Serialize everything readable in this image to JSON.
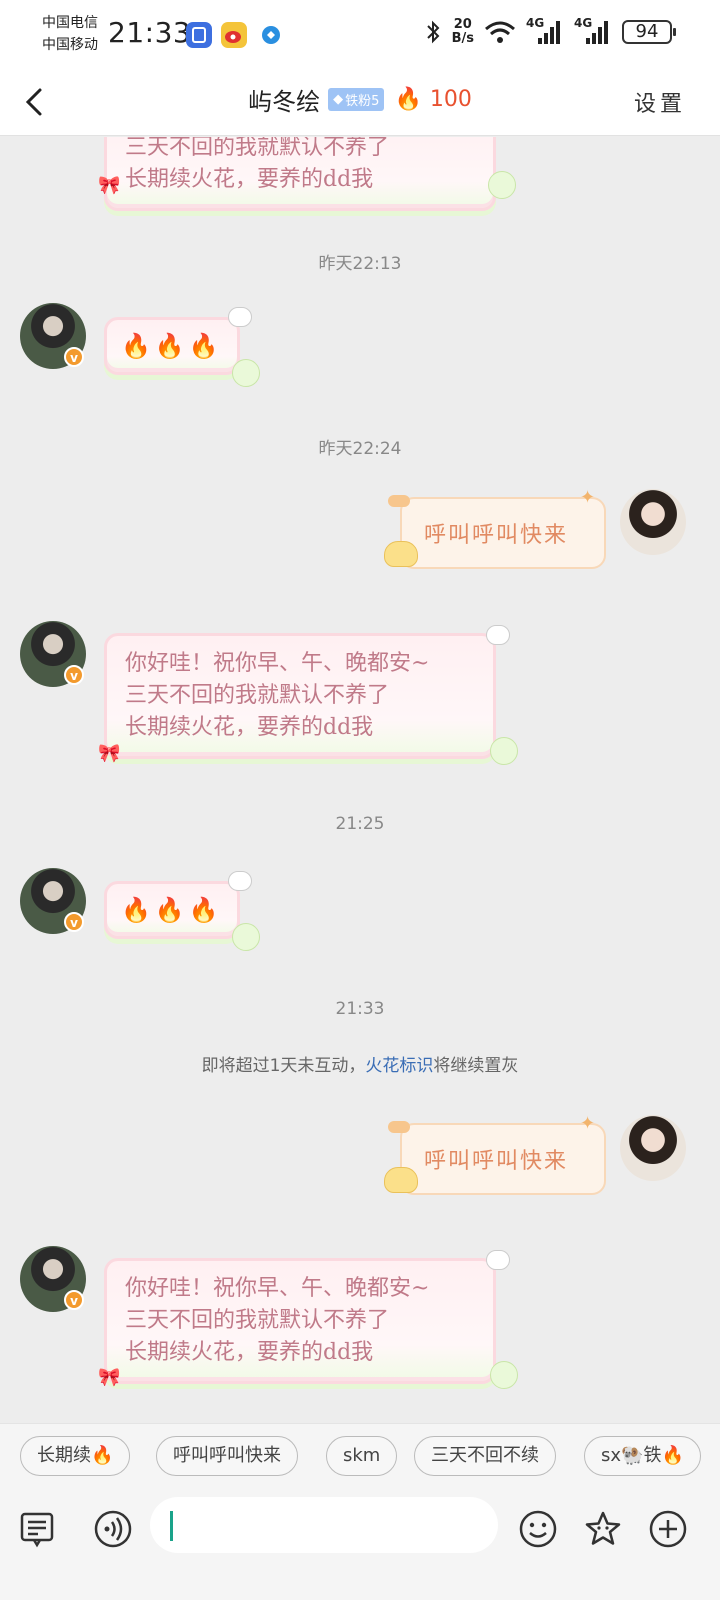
{
  "status_bar": {
    "carrier_1": "中国电信",
    "carrier_2": "中国移动",
    "time": "21:33",
    "net_speed_value": "20",
    "net_speed_unit": "B/s",
    "signal_1": "4G",
    "signal_2": "4G",
    "battery": "94"
  },
  "nav": {
    "title": "屿冬绘",
    "fan_badge": "铁粉5",
    "spark_count": "100",
    "settings_label": "设置"
  },
  "messages": {
    "msg_top": {
      "line1": "三天不回的我就默认不养了",
      "line2": "长期续火花，要养的dd我"
    },
    "time_1": "昨天22:13",
    "msg_fire_1": "🔥🔥🔥",
    "time_2": "昨天22:24",
    "msg_out_1": "呼叫呼叫快来",
    "msg_greet_1": {
      "line1": "你好哇！祝你早、午、晚都安~",
      "line2": "三天不回的我就默认不养了",
      "line3": "长期续火花，要养的dd我"
    },
    "time_3": "21:25",
    "msg_fire_2": "🔥🔥🔥",
    "time_4": "21:33",
    "system_notice": {
      "before": "即将超过1天未互动，",
      "link": "火花标识",
      "after": "将继续置灰"
    },
    "msg_out_2": "呼叫呼叫快来",
    "msg_greet_2": {
      "line1": "你好哇！祝你早、午、晚都安~",
      "line2": "三天不回的我就默认不养了",
      "line3": "长期续火花，要养的dd我"
    }
  },
  "quick_replies": [
    "长期续🔥",
    "呼叫呼叫快来",
    "skm",
    "三天不回不续",
    "sx🐏铁🔥"
  ],
  "colors": {
    "accent_link": "#3a6db5",
    "spark": "#e8512f",
    "caret": "#1aa38a"
  }
}
